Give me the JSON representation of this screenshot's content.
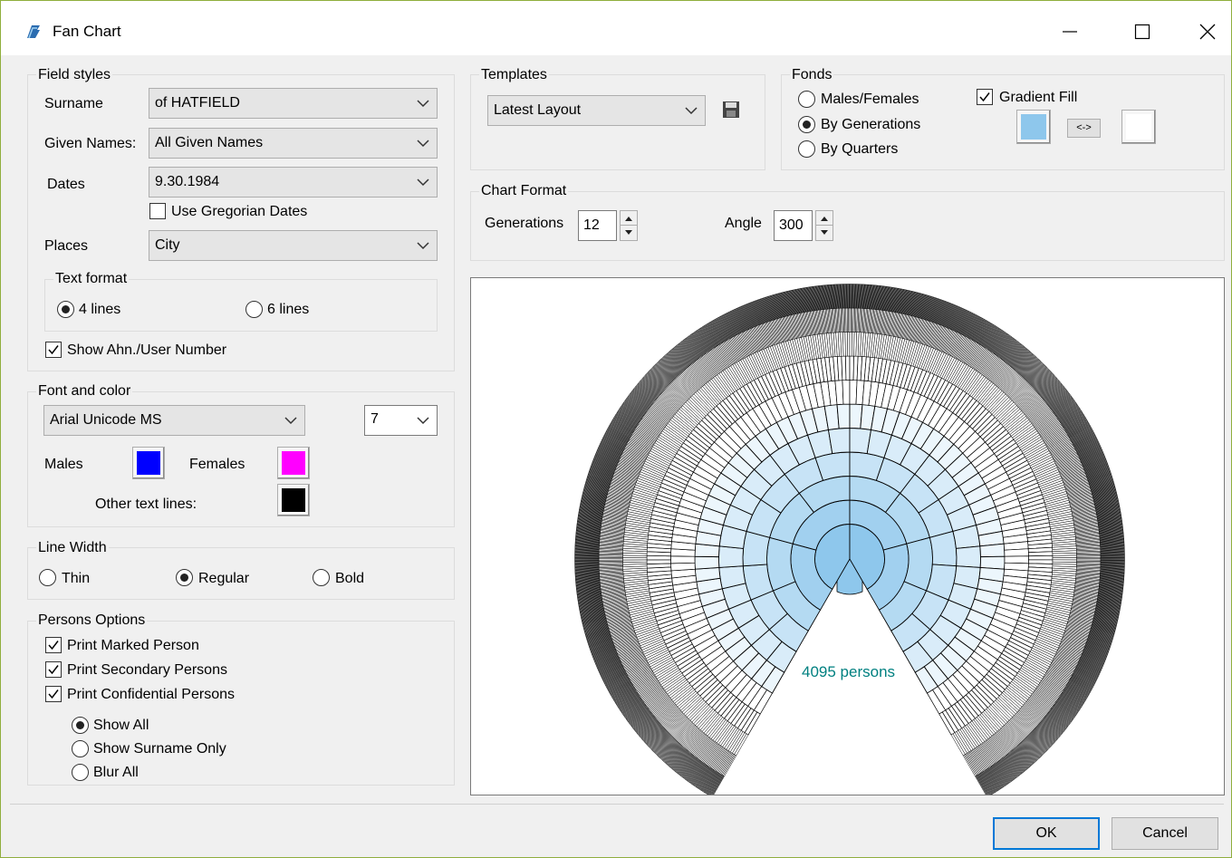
{
  "window": {
    "title": "Fan Chart"
  },
  "field_styles": {
    "legend": "Field styles",
    "surname_label": "Surname",
    "surname_value": "of HATFIELD",
    "given_names_label": "Given Names:",
    "given_names_value": "All Given Names",
    "dates_label": "Dates",
    "dates_value": "9.30.1984",
    "use_gregorian_label": "Use Gregorian Dates",
    "places_label": "Places",
    "places_value": "City",
    "text_format": {
      "legend": "Text format",
      "opt_4": "4 lines",
      "opt_6": "6 lines",
      "selected": "4 lines"
    },
    "show_ahn_label": "Show Ahn./User Number"
  },
  "font_and_color": {
    "legend": "Font and color",
    "font_value": "Arial Unicode MS",
    "size_value": "7",
    "males_label": "Males",
    "females_label": "Females",
    "other_label": "Other text lines:",
    "colors": {
      "males": "#0000ff",
      "females": "#ff00ff",
      "other": "#000000"
    }
  },
  "line_width": {
    "legend": "Line Width",
    "opt_thin": "Thin",
    "opt_regular": "Regular",
    "opt_bold": "Bold",
    "selected": "Regular"
  },
  "persons_options": {
    "legend": "Persons Options",
    "print_marked": "Print Marked Person",
    "print_secondary": "Print Secondary Persons",
    "print_confidential": "Print Confidential Persons",
    "show_all": "Show All",
    "show_surname_only": "Show Surname Only",
    "blur_all": "Blur All",
    "selected": "Show All"
  },
  "templates": {
    "legend": "Templates",
    "value": "Latest Layout"
  },
  "fonds": {
    "legend": "Fonds",
    "opt_males_females": "Males/Females",
    "opt_by_generations": "By Generations",
    "opt_by_quarters": "By Quarters",
    "selected": "By Generations",
    "gradient_fill_label": "Gradient Fill",
    "swap_label": "<->",
    "colors": {
      "start": "#8ec7ec",
      "end": "#ffffff"
    }
  },
  "chart_format": {
    "legend": "Chart Format",
    "generations_label": "Generations",
    "generations_value": "12",
    "angle_label": "Angle",
    "angle_value": "300"
  },
  "preview": {
    "persons_text": "4095  persons",
    "generations": 12,
    "angle": 300
  },
  "buttons": {
    "ok": "OK",
    "cancel": "Cancel"
  }
}
